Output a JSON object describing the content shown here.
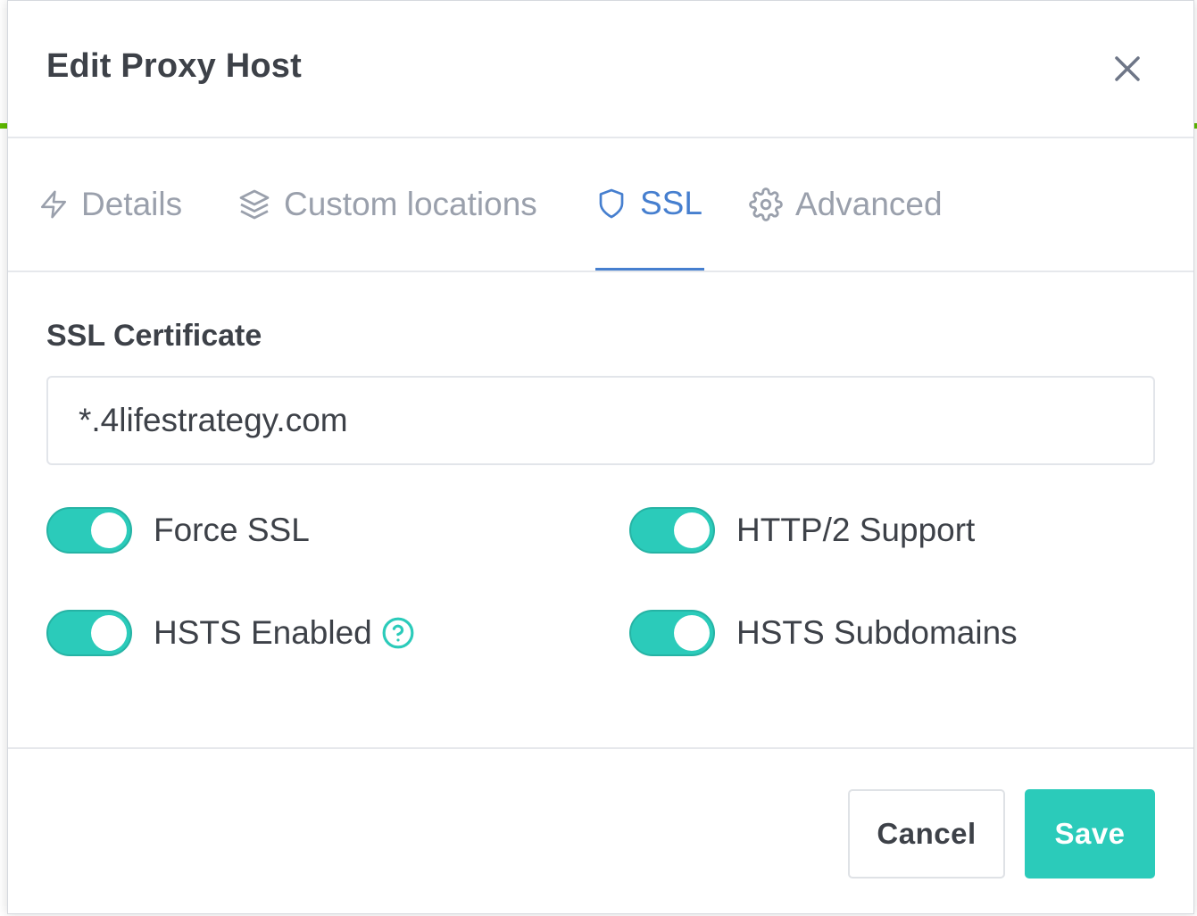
{
  "modal": {
    "title": "Edit Proxy Host",
    "close_icon": "close-icon"
  },
  "tabs": [
    {
      "label": "Details",
      "icon": "lightning-icon",
      "active": false
    },
    {
      "label": "Custom locations",
      "icon": "layers-icon",
      "active": false
    },
    {
      "label": "SSL",
      "icon": "shield-icon",
      "active": true
    },
    {
      "label": "Advanced",
      "icon": "gear-icon",
      "active": false
    }
  ],
  "ssl": {
    "certificate_label": "SSL Certificate",
    "certificate_value": "*.4lifestrategy.com",
    "toggles": [
      {
        "label": "Force SSL",
        "on": true
      },
      {
        "label": "HTTP/2 Support",
        "on": true
      },
      {
        "label": "HSTS Enabled",
        "on": true,
        "help_icon": "question-circle-icon"
      },
      {
        "label": "HSTS Subdomains",
        "on": true
      }
    ]
  },
  "footer": {
    "cancel_label": "Cancel",
    "save_label": "Save"
  },
  "colors": {
    "accent_blue": "#467fcf",
    "toggle_teal": "#2bcbba",
    "text_dark": "#3d4148",
    "text_muted": "#9aa0ac"
  }
}
